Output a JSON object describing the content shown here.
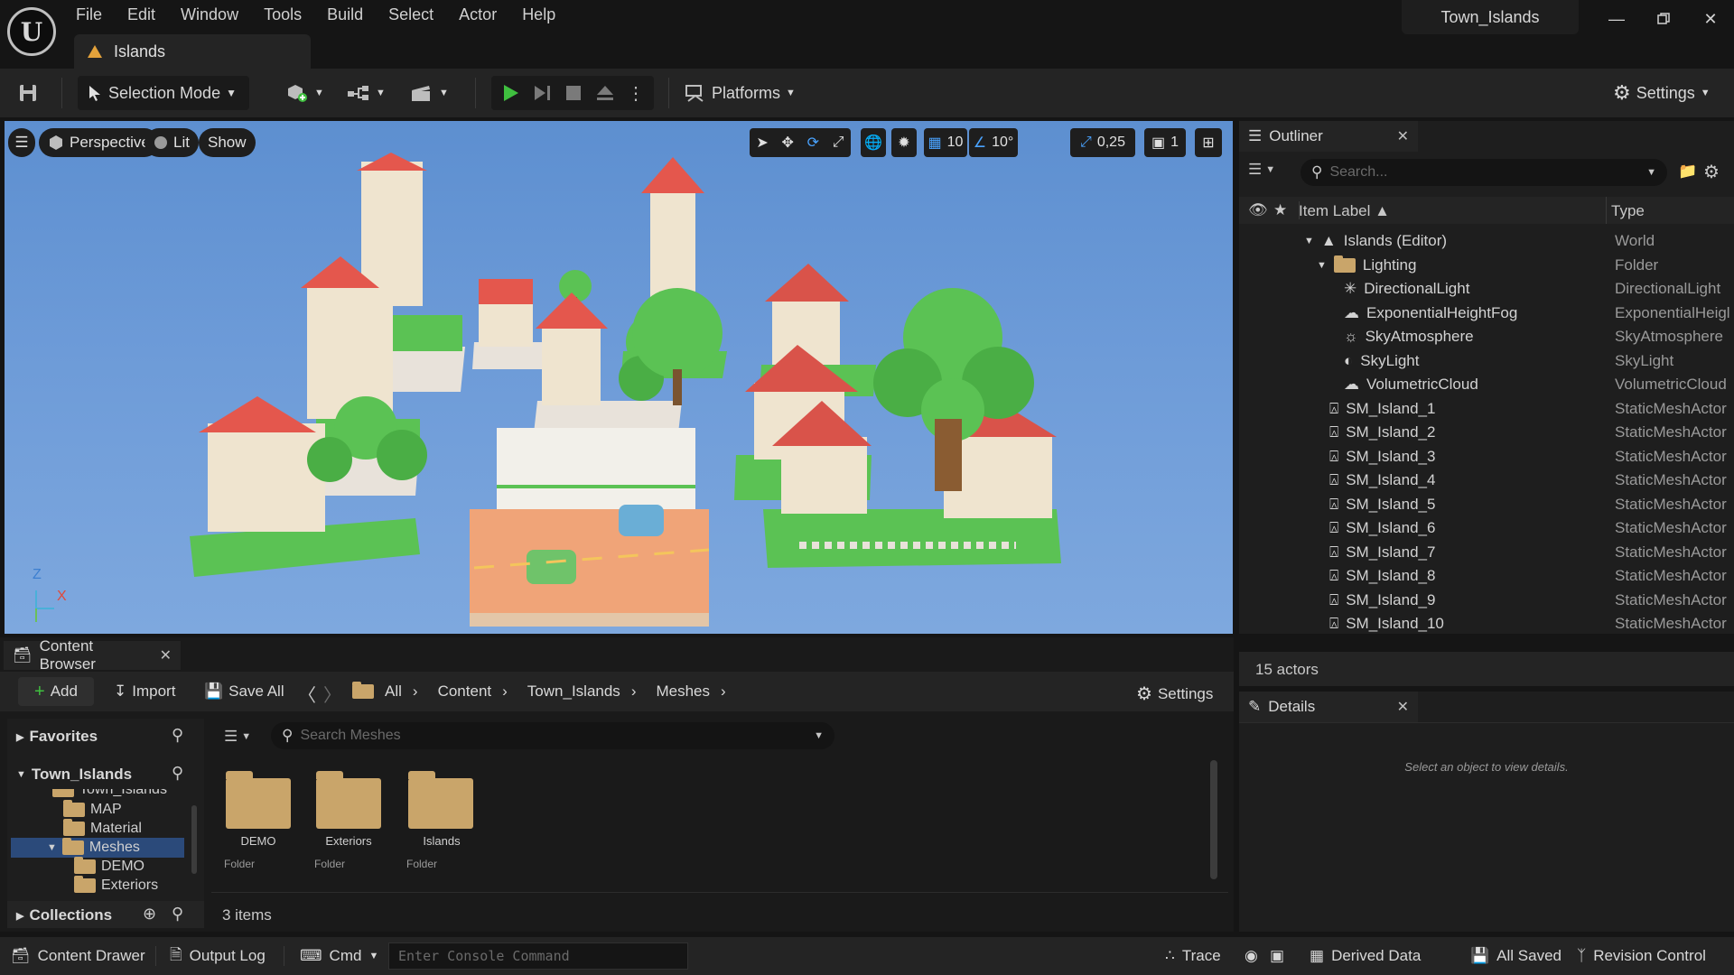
{
  "app": {
    "logo_text": "U"
  },
  "menu": [
    "File",
    "Edit",
    "Window",
    "Tools",
    "Build",
    "Select",
    "Actor",
    "Help"
  ],
  "project_title": "Town_Islands",
  "level_tab": "Islands",
  "toolbar": {
    "selection_mode": "Selection Mode",
    "platforms": "Platforms",
    "settings": "Settings"
  },
  "viewport": {
    "perspective": "Perspective",
    "lit": "Lit",
    "show": "Show",
    "grid_snap": "10",
    "rotation_snap": "10°",
    "scale_snap": "0,25",
    "camera_speed": "1",
    "axis_z": "Z",
    "axis_x": "X"
  },
  "outliner": {
    "title": "Outliner",
    "search_placeholder": "Search...",
    "col_label": "Item Label",
    "col_type": "Type",
    "rows": [
      {
        "label": "Islands (Editor)",
        "type": "World"
      },
      {
        "label": "Lighting",
        "type": "Folder"
      },
      {
        "label": "DirectionalLight",
        "type": "DirectionalLight"
      },
      {
        "label": "ExponentialHeightFog",
        "type": "ExponentialHeigl"
      },
      {
        "label": "SkyAtmosphere",
        "type": "SkyAtmosphere"
      },
      {
        "label": "SkyLight",
        "type": "SkyLight"
      },
      {
        "label": "VolumetricCloud",
        "type": "VolumetricCloud"
      },
      {
        "label": "SM_Island_1",
        "type": "StaticMeshActor"
      },
      {
        "label": "SM_Island_2",
        "type": "StaticMeshActor"
      },
      {
        "label": "SM_Island_3",
        "type": "StaticMeshActor"
      },
      {
        "label": "SM_Island_4",
        "type": "StaticMeshActor"
      },
      {
        "label": "SM_Island_5",
        "type": "StaticMeshActor"
      },
      {
        "label": "SM_Island_6",
        "type": "StaticMeshActor"
      },
      {
        "label": "SM_Island_7",
        "type": "StaticMeshActor"
      },
      {
        "label": "SM_Island_8",
        "type": "StaticMeshActor"
      },
      {
        "label": "SM_Island_9",
        "type": "StaticMeshActor"
      },
      {
        "label": "SM_Island_10",
        "type": "StaticMeshActor"
      }
    ],
    "actor_count": "15 actors"
  },
  "details": {
    "title": "Details",
    "empty_text": "Select an object to view details."
  },
  "content_browser": {
    "title": "Content Browser",
    "add": "Add",
    "import": "Import",
    "save_all": "Save All",
    "breadcrumb": [
      "All",
      "Content",
      "Town_Islands",
      "Meshes"
    ],
    "settings": "Settings",
    "favorites": "Favorites",
    "root": "Town_Islands",
    "tree": [
      "Town_Islands",
      "MAP",
      "Material",
      "Meshes",
      "DEMO",
      "Exteriors"
    ],
    "collections": "Collections",
    "search_placeholder": "Search Meshes",
    "assets": [
      {
        "name": "DEMO",
        "kind": "Folder"
      },
      {
        "name": "Exteriors",
        "kind": "Folder"
      },
      {
        "name": "Islands",
        "kind": "Folder"
      }
    ],
    "item_count": "3 items"
  },
  "statusbar": {
    "content_drawer": "Content Drawer",
    "output_log": "Output Log",
    "cmd": "Cmd",
    "console_placeholder": "Enter Console Command",
    "trace": "Trace",
    "derived_data": "Derived Data",
    "all_saved": "All Saved",
    "revision_control": "Revision Control"
  },
  "colors": {
    "accent_play": "#3fbf3f",
    "selection": "#2b4a7a",
    "folder": "#c9a56a"
  }
}
